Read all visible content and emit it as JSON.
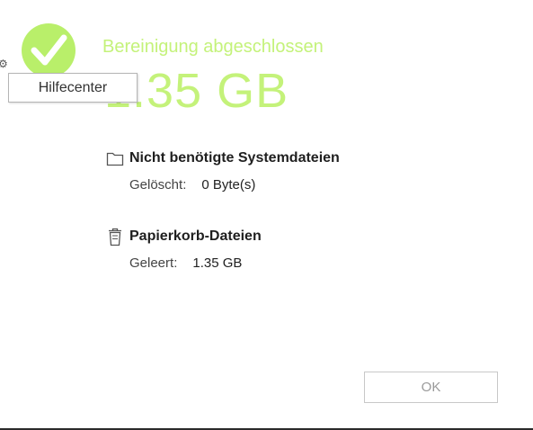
{
  "header": {
    "title": "Bereinigung abgeschlossen",
    "total_size": "1.35 GB"
  },
  "tooltip": {
    "text": "Hilfecenter"
  },
  "sections": [
    {
      "icon": "folder-icon",
      "title": "Nicht benötigte Systemdateien",
      "label": "Gelöscht:",
      "value": "0 Byte(s)"
    },
    {
      "icon": "trash-icon",
      "title": "Papierkorb-Dateien",
      "label": "Geleert:",
      "value": "1.35 GB"
    }
  ],
  "footer": {
    "ok_label": "OK"
  },
  "colors": {
    "accent": "#c4f27a",
    "check_badge": "#b9ef6a"
  },
  "icons": {
    "status": "checkmark-icon",
    "edge": "gear-icon"
  }
}
